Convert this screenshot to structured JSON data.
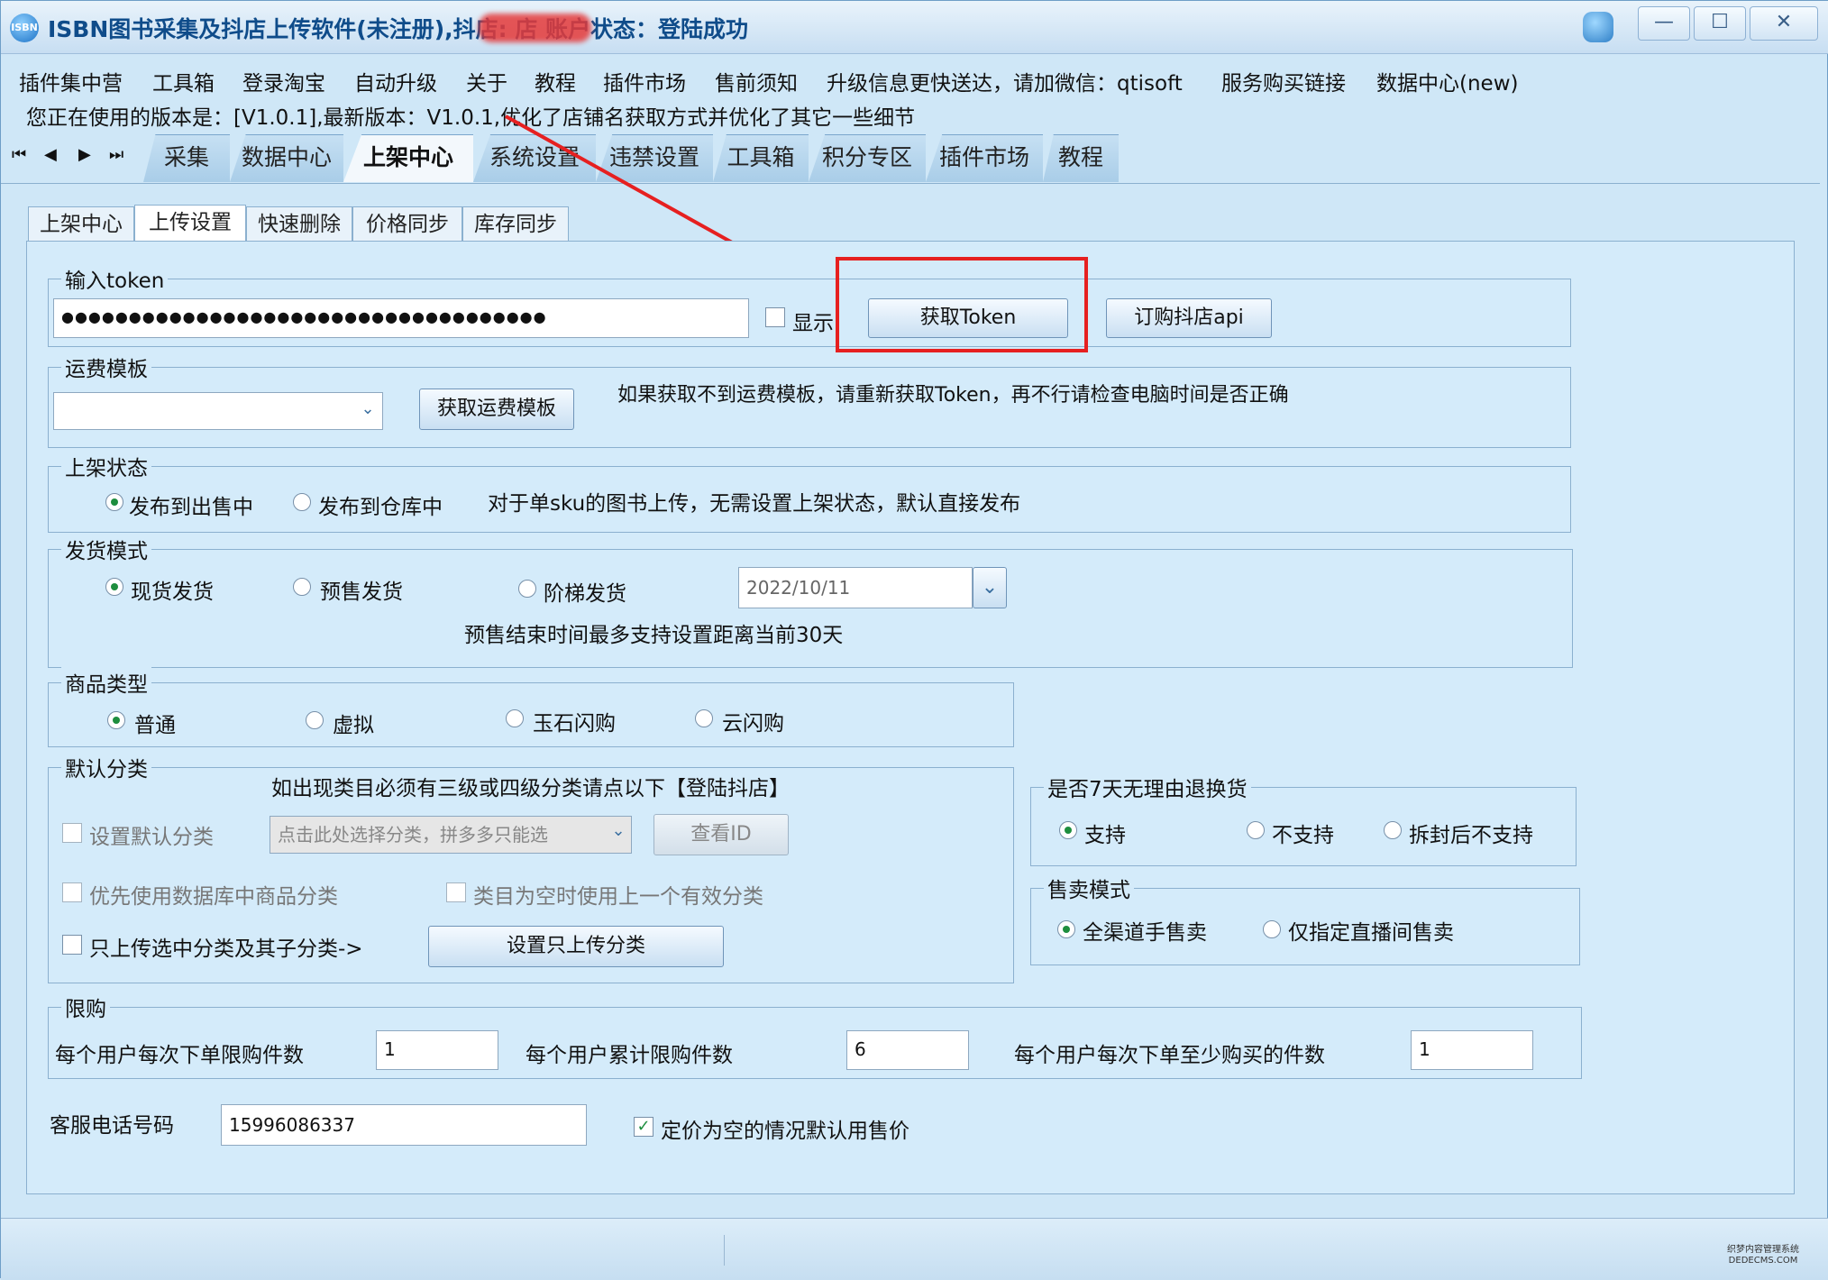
{
  "title": {
    "app_icon_text": "ISBN",
    "text": "ISBN图书采集及抖店上传软件(未注册),抖店:                         店 账户状态：登陆成功"
  },
  "menu": [
    "插件集中营",
    "工具箱",
    "登录淘宝",
    "自动升级",
    "关于",
    "教程",
    "插件市场",
    "售前须知",
    "升级信息更快送达，请加微信：qtisoft",
    "服务购买链接",
    "数据中心(new)"
  ],
  "version_text": "您正在使用的版本是：[V1.0.1],最新版本：V1.0.1,优化了店铺名获取方式并优化了其它一些细节",
  "main_tabs": [
    "采集",
    "数据中心",
    "上架中心",
    "系统设置",
    "违禁设置",
    "工具箱",
    "积分专区",
    "插件市场",
    "教程"
  ],
  "sub_tabs": [
    "上架中心",
    "上传设置",
    "快速删除",
    "价格同步",
    "库存同步"
  ],
  "token": {
    "label": "输入token",
    "value": "●●●●●●●●●●●●●●●●●●●●●●●●●●●●●●●●●●●●",
    "show_label": "显示",
    "get_button": "获取Token",
    "order_button": "订购抖店api"
  },
  "freight": {
    "label": "运费模板",
    "select_value": "",
    "button": "获取运费模板",
    "hint": "如果获取不到运费模板，请重新获取Token，再不行请检查电脑时间是否正确"
  },
  "listing": {
    "label": "上架状态",
    "opt1": "发布到出售中",
    "opt2": "发布到仓库中",
    "note": "对于单sku的图书上传，无需设置上架状态，默认直接发布"
  },
  "delivery": {
    "label": "发货模式",
    "opt1": "现货发货",
    "opt2": "预售发货",
    "opt3": "阶梯发货",
    "date": "2022/10/11",
    "note": "预售结束时间最多支持设置距离当前30天"
  },
  "product_type": {
    "label": "商品类型",
    "opt1": "普通",
    "opt2": "虚拟",
    "opt3": "玉石闪购",
    "opt4": "云闪购"
  },
  "category": {
    "label": "默认分类",
    "hint": "如出现类目必须有三级或四级分类请点以下【登陆抖店】",
    "set_default": "设置默认分类",
    "select_text": "点击此处选择分类，拼多多只能选",
    "view_id": "查看ID",
    "prefer_db": "优先使用数据库中商品分类",
    "use_prev": "类目为空时使用上一个有效分类",
    "only_upload": "只上传选中分类及其子分类->",
    "only_upload_btn": "设置只上传分类"
  },
  "return7": {
    "label": "是否7天无理由退换货",
    "opt1": "支持",
    "opt2": "不支持",
    "opt3": "拆封后不支持"
  },
  "sale_mode": {
    "label": "售卖模式",
    "opt1": "全渠道手售卖",
    "opt2": "仅指定直播间售卖"
  },
  "limit": {
    "label": "限购",
    "per_order": "每个用户每次下单限购件数",
    "per_order_val": "1",
    "total": "每个用户累计限购件数",
    "total_val": "6",
    "min": "每个用户每次下单至少购买的件数",
    "min_val": "1"
  },
  "service_phone": {
    "label": "客服电话号码",
    "value": "15996086337",
    "default_price": "定价为空的情况默认用售价"
  },
  "watermark": {
    "line1": "织梦内容管理系统",
    "line2": "DEDECMS.COM"
  },
  "colors": {
    "accent": "#1b72c6",
    "highlight": "#e62020"
  }
}
